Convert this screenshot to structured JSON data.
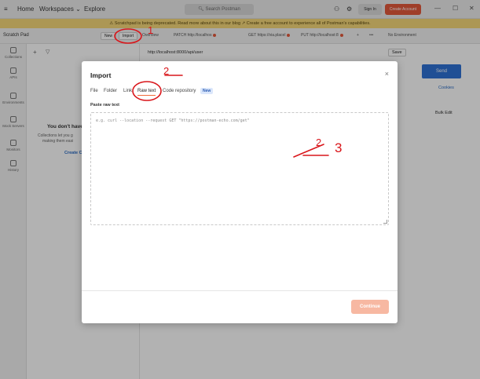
{
  "topbar": {
    "home": "Home",
    "workspaces": "Workspaces ⌄",
    "explore": "Explore",
    "search_placeholder": "Search Postman",
    "signin": "Sign In",
    "create_account": "Create Account",
    "window_controls": [
      "—",
      "☐",
      "✕"
    ]
  },
  "banner": {
    "text": "⚠ Scratchpad is being deprecated. Read more about this in our blog ↗ Create a free account to experience all of Postman's capabilities."
  },
  "row2": {
    "title": "Scratch Pad",
    "new_button": "New",
    "import_button": "Import",
    "overview_tab": "Overview",
    "tabs": [
      {
        "method": "PATCH",
        "label": "http://localhos"
      },
      {
        "method": "GET",
        "label": "https://via.placel"
      },
      {
        "method": "PUT",
        "label": "http://localhost:8"
      }
    ],
    "plus": "+",
    "more": "•••",
    "environment": "No Environment"
  },
  "rail": [
    {
      "label": "Collections",
      "icon": "collections-icon"
    },
    {
      "label": "APIs",
      "icon": "apis-icon"
    },
    {
      "label": "Environments",
      "icon": "environments-icon"
    },
    {
      "label": "Mock Servers",
      "icon": "mock-servers-icon"
    },
    {
      "label": "Monitors",
      "icon": "monitors-icon"
    },
    {
      "label": "History",
      "icon": "history-icon"
    }
  ],
  "background": {
    "url": "http://localhost:8000/api/user",
    "save": "Save",
    "send": "Send",
    "cookies": "Cookies",
    "bulk_edit": "Bulk Edit",
    "empty_title": "You don't have",
    "empty_sub_1": "Collections let you g",
    "empty_sub_2": "making them easi",
    "create": "Create C"
  },
  "modal": {
    "title": "Import",
    "close": "×",
    "tabs": [
      "File",
      "Folder",
      "Link",
      "Raw text",
      "Code repository"
    ],
    "active_tab": "Raw text",
    "new_badge": "New",
    "paste_label": "Paste raw text",
    "placeholder": "e.g. curl --location --request GET \"https://postman-echo.com/get\"",
    "continue": "Continue"
  },
  "annotations": {
    "marks": [
      "1",
      "2",
      "2",
      "3"
    ],
    "color": "#d9161b"
  },
  "colors": {
    "accent": "#e45a3c",
    "continue_disabled": "#f7b8a2",
    "banner": "#f6d87a",
    "new_badge_bg": "#dbe7fb"
  }
}
